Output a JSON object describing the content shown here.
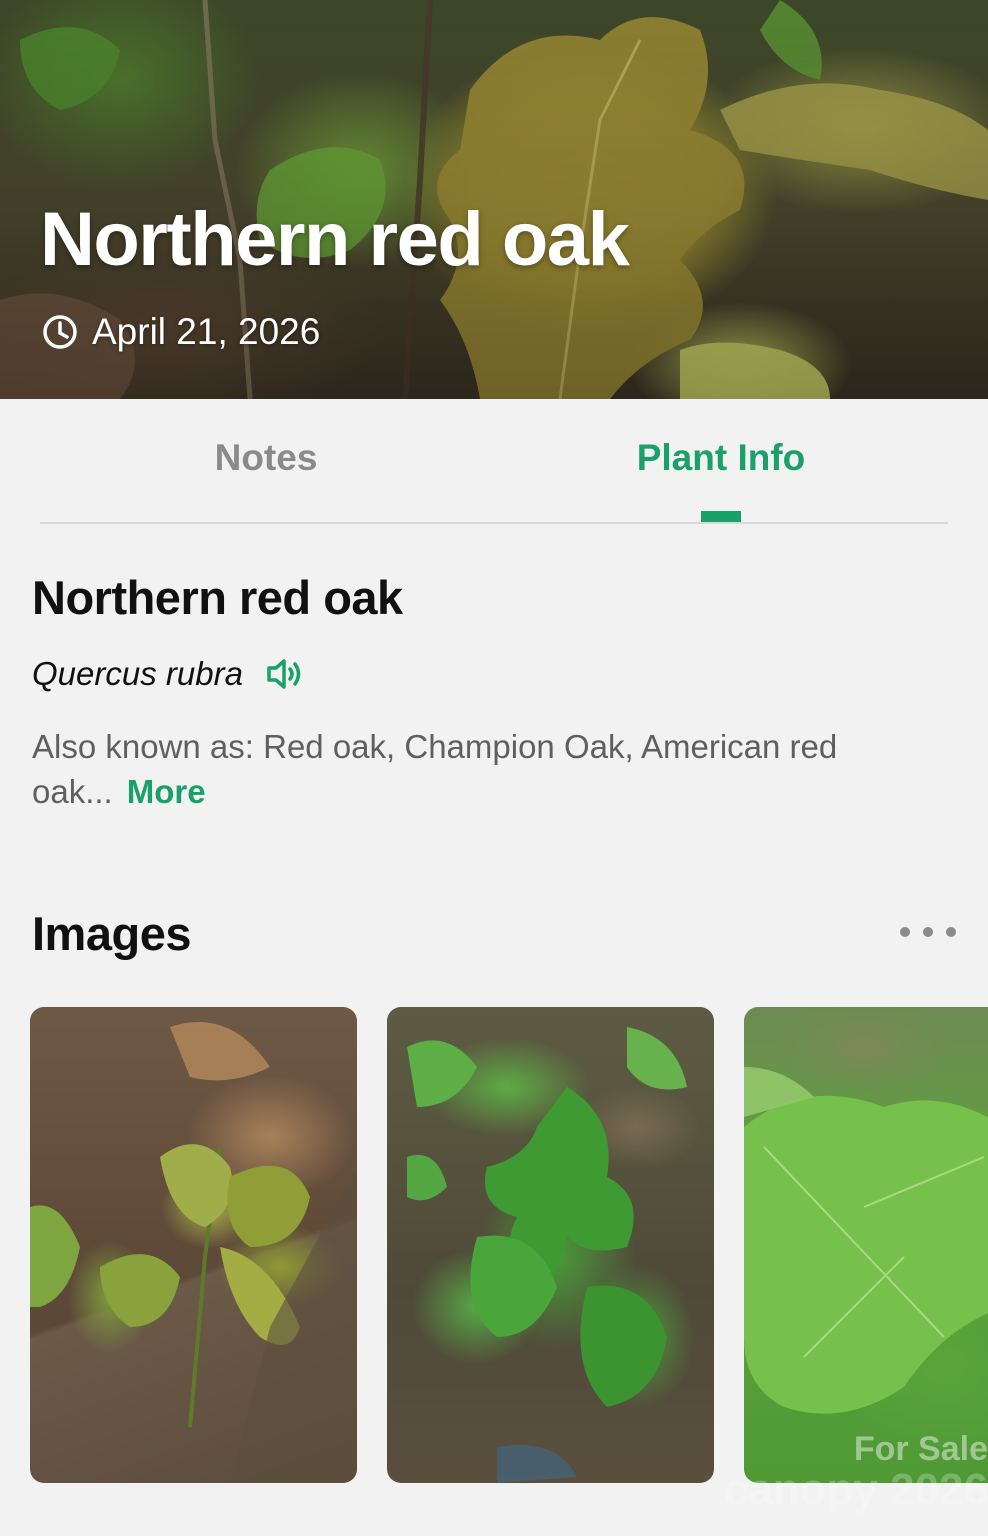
{
  "hero": {
    "title": "Northern red oak",
    "date": "April 21, 2026",
    "icon": "clock-icon"
  },
  "tabs": [
    {
      "label": "Notes",
      "active": false
    },
    {
      "label": "Plant Info",
      "active": true
    }
  ],
  "plant": {
    "common_name": "Northern red oak",
    "scientific_name": "Quercus rubra",
    "pronounce_icon": "speaker-icon",
    "also_known_as": "Also known as: Red oak, Champion Oak, American red oak...",
    "more_label": "More"
  },
  "images_section": {
    "title": "Images",
    "menu_icon": "ellipsis-icon",
    "thumbnail_count_visible": 3
  },
  "watermark": {
    "line1": "For Sale",
    "line2": "canopy 2026"
  },
  "colors": {
    "accent": "#1aa06a",
    "inactive_tab": "#8a8a8a",
    "background": "#f2f2f2",
    "text_primary": "#111111",
    "text_secondary": "#5f5f5f"
  }
}
